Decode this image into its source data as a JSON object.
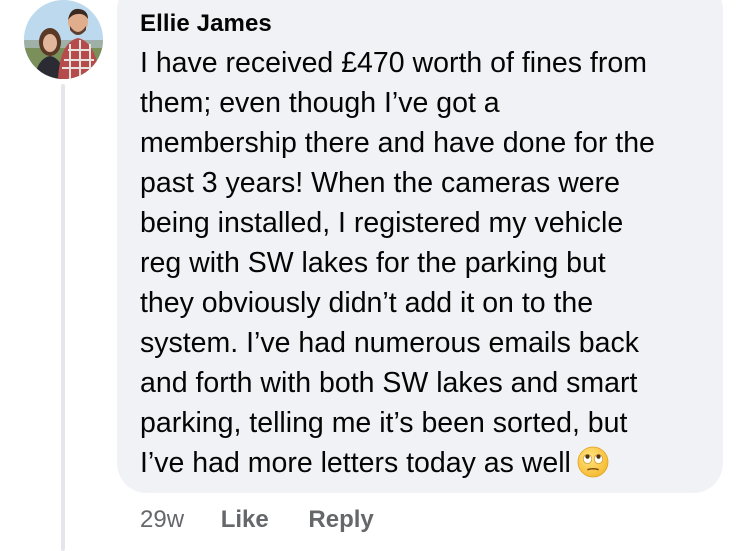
{
  "comment": {
    "author": "Ellie James",
    "text_lines": [
      "I have received £470 worth of fines from",
      "them; even though I’ve got a",
      "membership there and have done for the",
      "past 3 years! When the cameras were",
      "being installed, I registered my vehicle",
      "reg with SW lakes for the parking but",
      "they obviously didn’t add it on to the",
      "system. I’ve had numerous emails back",
      "and forth with both SW lakes and smart",
      "parking, telling me it’s been sorted, but",
      "I’ve had more letters today as well"
    ],
    "emoji_icon": "eye-roll-emoji-icon"
  },
  "meta": {
    "time": "29w",
    "like_label": "Like",
    "reply_label": "Reply"
  },
  "colors": {
    "bubble": "#f0f2f5",
    "text": "#050505",
    "meta_text": "#65676b",
    "thread_line": "#e4e6eb"
  }
}
